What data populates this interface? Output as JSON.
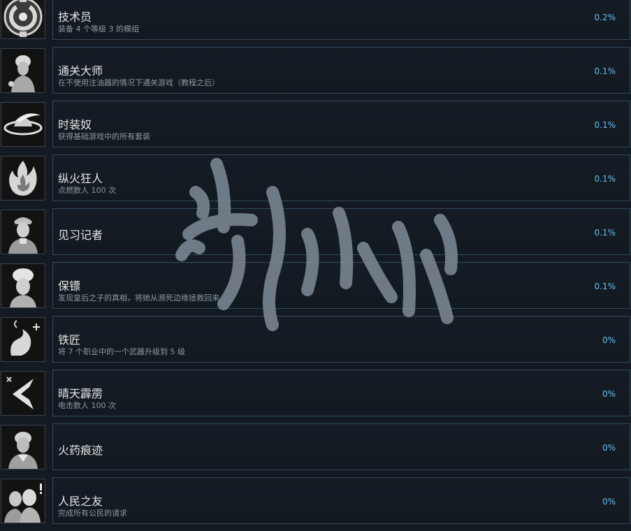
{
  "achievements": [
    {
      "title": "技术员",
      "desc": "装备 4 个等级 3 的模组",
      "pct": "0.2%",
      "icon": "gear-medallion-icon"
    },
    {
      "title": "通关大师",
      "desc": "在不使用注油器的情况下通关游戏（教程之后）",
      "pct": "0.1%",
      "icon": "noble-lady-portrait-icon"
    },
    {
      "title": "时装奴",
      "desc": "获得基础游戏中的所有套装",
      "pct": "0.1%",
      "icon": "feathered-hat-icon"
    },
    {
      "title": "纵火狂人",
      "desc": "点燃数人 100 次",
      "pct": "0.1%",
      "icon": "flame-icon"
    },
    {
      "title": "见习记者",
      "desc": "",
      "pct": "0.1%",
      "icon": "reporter-portrait-icon"
    },
    {
      "title": "保镖",
      "desc": "发现皇后之子的真相，将她从濒死边缘拯救回来",
      "pct": "0.1%",
      "icon": "queen-portrait-icon"
    },
    {
      "title": "铁匠",
      "desc": "将 7 个职业中的一个武器升级到 5 级",
      "pct": "0%",
      "icon": "blacksmith-swirl-icon"
    },
    {
      "title": "晴天霹雳",
      "desc": "电击数人 100 次",
      "pct": "0%",
      "icon": "lightning-bolt-icon"
    },
    {
      "title": "火药痕迹",
      "desc": "",
      "pct": "0%",
      "icon": "gentleman-portrait-icon"
    },
    {
      "title": "人民之友",
      "desc": "完成所有公民的请求",
      "pct": "0%",
      "icon": "citizens-portrait-icon"
    }
  ],
  "watermark": {
    "text": "游侠网",
    "color": "#7f8b97"
  }
}
